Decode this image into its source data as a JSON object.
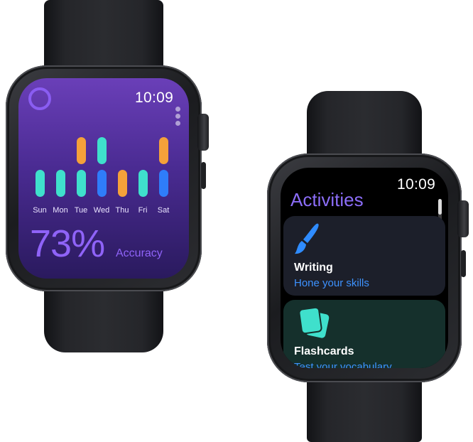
{
  "left_watch": {
    "time": "10:09",
    "days": [
      "Sun",
      "Mon",
      "Tue",
      "Wed",
      "Thu",
      "Fri",
      "Sat"
    ],
    "accuracy_value": "73%",
    "accuracy_label": "Accuracy",
    "colors": {
      "teal": "#3fe0cc",
      "orange": "#f5a13a",
      "blue": "#2f7dfa",
      "purple": "#8f63f8"
    }
  },
  "right_watch": {
    "time": "10:09",
    "title": "Activities",
    "cards": [
      {
        "title": "Writing",
        "subtitle": "Hone your skills",
        "icon": "paintbrush-icon"
      },
      {
        "title": "Flashcards",
        "subtitle": "Test your vocabulary",
        "icon": "flashcards-icon"
      }
    ]
  }
}
